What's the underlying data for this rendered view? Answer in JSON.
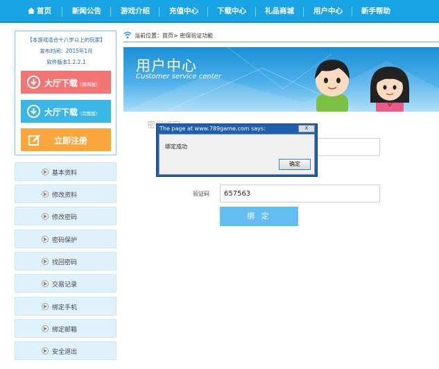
{
  "nav": {
    "home": "首页",
    "items": [
      "新闻公告",
      "游戏介绍",
      "充值中心",
      "下载中心",
      "礼品商城",
      "用户中心",
      "新手帮助"
    ]
  },
  "side": {
    "notice": "【本游戏适合十八岁以上的玩家】",
    "release": "发布时间：2015年1月",
    "version": "软件版本1.2.2.1",
    "btn1": {
      "label": "大厅下载",
      "sub": "（精简版）"
    },
    "btn2": {
      "label": "大厅下载",
      "sub": "（完整版）"
    },
    "btn3": {
      "label": "立即注册"
    },
    "menu": [
      "基本资料",
      "修改资料",
      "修改密码",
      "密码保护",
      "找回密码",
      "交易记录",
      "绑定手机",
      "绑定邮箱",
      "安全退出"
    ]
  },
  "breadcrumb": "当前位置：首页> 密保验证功能",
  "banner": {
    "title": "用户中心",
    "subtitle": "Customer service center"
  },
  "form": {
    "ghost_heading": "密保绑定",
    "code_label": "验证码",
    "code_value": "657563",
    "submit": "绑 定"
  },
  "dialog": {
    "title": "The page at www.789game.com says:",
    "close": "X",
    "message": "绑定成功",
    "ok": "确定"
  },
  "colors": {
    "nav": "#17a3e4",
    "download_btn": "#f37676",
    "download_btn2": "#3bb6e7",
    "register_btn": "#f9a63d",
    "menu_bg": "#dff2fb",
    "bind_btn": "#62bdf0",
    "dialog_title": "#1f5fb0"
  }
}
